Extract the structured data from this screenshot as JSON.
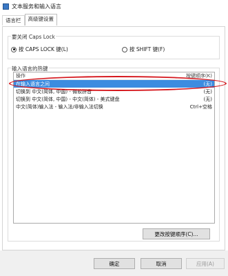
{
  "window": {
    "title": "文本服务和输入语言"
  },
  "tabs": [
    {
      "label": "语言栏"
    },
    {
      "label": "高级键设置"
    }
  ],
  "caps_lock": {
    "group_title": "要关闭 Caps Lock",
    "option_caps": "按 CAPS LOCK 键(L)",
    "option_shift": "按 SHIFT 键(F)",
    "selected": "option_caps"
  },
  "hotkeys": {
    "group_title": "输入语言的热键",
    "header_left": "操作",
    "header_right": "按键顺序(K)",
    "rows": [
      {
        "action": "在输入语言之间",
        "keys": "(无)",
        "selected": true
      },
      {
        "action": "切换到 中文(简体, 中国) - 微软拼音",
        "keys": "(无)",
        "selected": false
      },
      {
        "action": "切换到 中文(简体, 中国) - 中文(简体) - 美式键盘",
        "keys": "(无)",
        "selected": false
      },
      {
        "action": "中文(简体)输入法 - 输入法/非输入法切换",
        "keys": "Ctrl+空格",
        "selected": false
      }
    ],
    "change_button": "更改按键顺序(C)..."
  },
  "footer": {
    "ok": "确定",
    "cancel": "取消",
    "apply": "应用(A)"
  },
  "colors": {
    "selection": "#3c8ce0",
    "annotation": "#d5161c"
  }
}
